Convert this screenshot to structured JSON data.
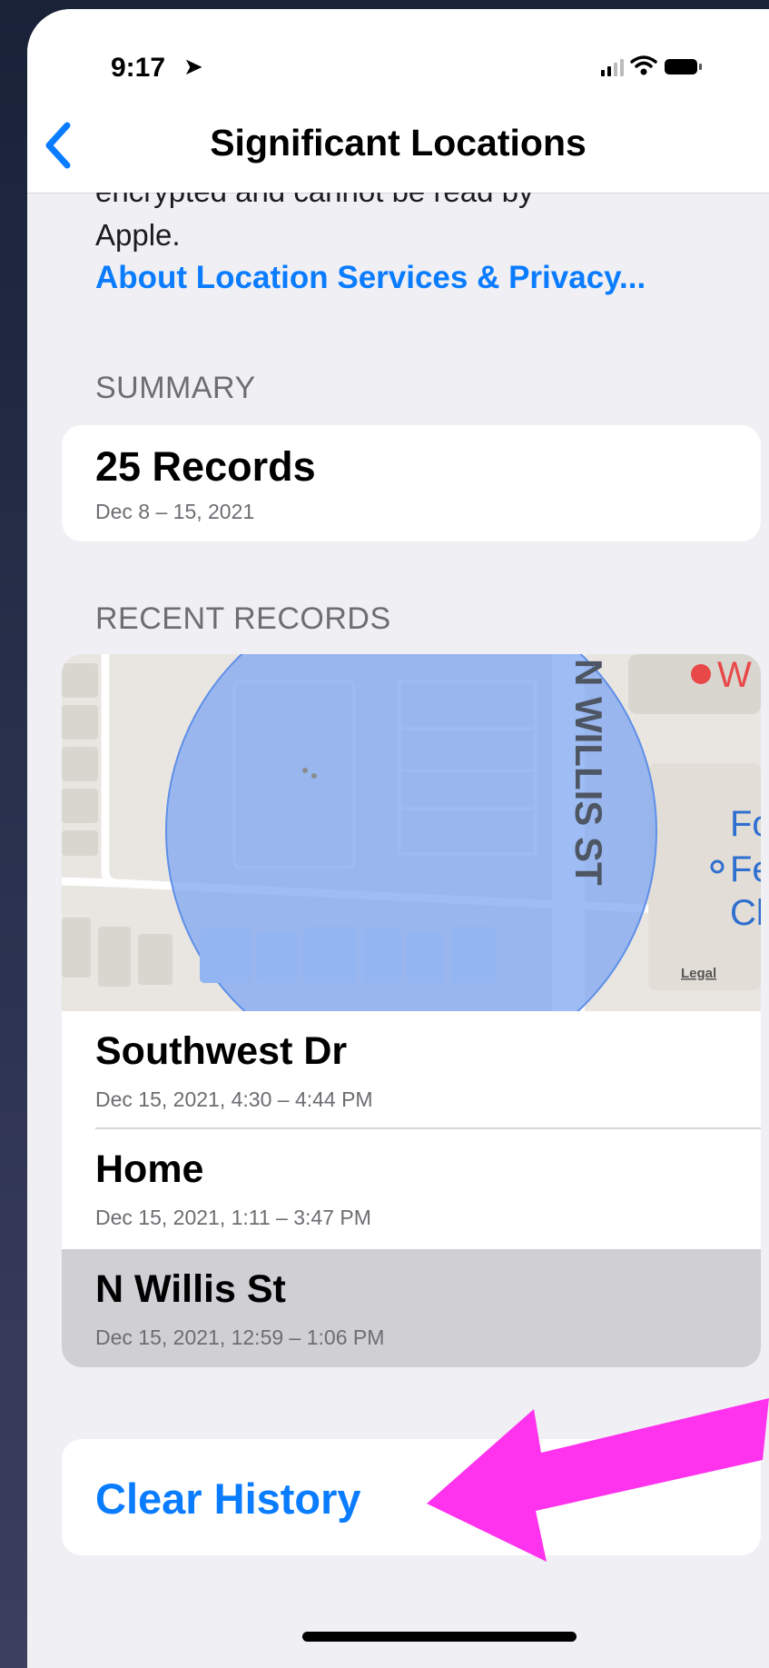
{
  "status": {
    "time": "9:17"
  },
  "nav": {
    "title": "Significant Locations"
  },
  "intro": {
    "cut_line": "encrypted and cannot be read by",
    "end_text": "Apple.",
    "link": "About Location Services & Privacy..."
  },
  "summary": {
    "header": "SUMMARY",
    "count": "25 Records",
    "range": "Dec 8 – 15, 2021"
  },
  "recent": {
    "header": "RECENT RECORDS",
    "map": {
      "street": "N WILLIS ST",
      "poi_w": "W",
      "poi_f1": "Fo",
      "poi_f2": "Fe",
      "poi_c": "Cl",
      "legal": "Legal"
    },
    "records": [
      {
        "title": "Southwest Dr",
        "subtitle": "Dec 15, 2021, 4:30 – 4:44 PM"
      },
      {
        "title": "Home",
        "subtitle": "Dec 15, 2021, 1:11 – 3:47 PM"
      },
      {
        "title": "N Willis St",
        "subtitle": "Dec 15, 2021, 12:59 – 1:06 PM"
      }
    ]
  },
  "clear": {
    "label": "Clear History"
  },
  "colors": {
    "link_blue": "#0a7cff",
    "highlight_row": "#cfcfd4",
    "arrow_magenta": "#ff33ee",
    "map_circle": "#7ea7f2"
  }
}
